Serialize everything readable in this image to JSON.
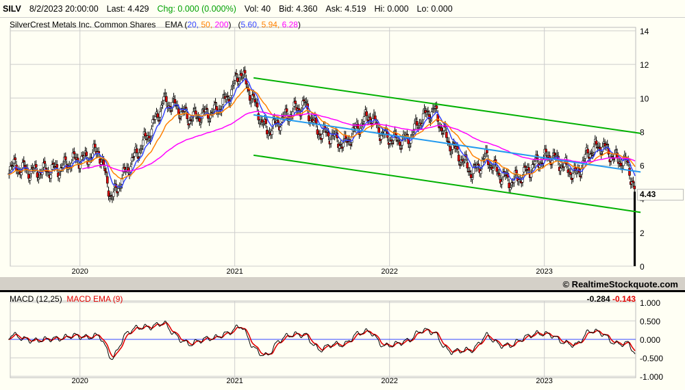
{
  "quote": {
    "symbol": "SILV",
    "datetime": "8/2/2023 20:00:00",
    "last": "Last: 4.429",
    "chg": "Chg: 0.000 (0.000%)",
    "vol": "Vol: 40",
    "bid": "Bid: 4.360",
    "ask": "Ask: 4.519",
    "hi": "Hi: 0.000",
    "lo": "Lo: 0.000"
  },
  "legend": {
    "name": "SilverCrest Metals Inc. Common Shares",
    "ema_label": "EMA",
    "p1": "20,",
    "p2": "50,",
    "p3": "200",
    "v1": "5.60,",
    "v2": "5.94,",
    "v3": "6.28"
  },
  "last_price_tag": "4.43",
  "copyright": "© RealtimeStockquote.com",
  "macd": {
    "label": "MACD (12,25)",
    "signal_label": "MACD EMA (9)",
    "value": "-0.284",
    "signal_value": "-0.143"
  },
  "colors": {
    "ema20": "#3344ff",
    "ema50": "#ff8000",
    "ema200": "#ff00ff",
    "channel": "#00b000",
    "regression": "#2299ee",
    "macd": "#000000",
    "signal": "#e00000",
    "zero": "#3344ff"
  },
  "chart_data": [
    {
      "type": "candlestick",
      "title": "SilverCrest Metals Inc. Common Shares",
      "x_ticks": [
        "2020",
        "2021",
        "2022",
        "2023"
      ],
      "y_ticks": [
        "0",
        "2",
        "4",
        "6",
        "8",
        "10",
        "12",
        "14"
      ],
      "ylim": [
        0,
        14
      ],
      "grid": true,
      "monthly_close": [
        [
          "2019-07",
          6.0
        ],
        [
          "2019-08",
          5.8
        ],
        [
          "2019-09",
          5.6
        ],
        [
          "2019-10",
          5.7
        ],
        [
          "2019-11",
          5.8
        ],
        [
          "2019-12",
          6.3
        ],
        [
          "2020-01",
          6.4
        ],
        [
          "2020-02",
          6.9
        ],
        [
          "2020-03",
          4.0
        ],
        [
          "2020-04",
          5.5
        ],
        [
          "2020-05",
          6.8
        ],
        [
          "2020-06",
          8.0
        ],
        [
          "2020-07",
          9.8
        ],
        [
          "2020-08",
          9.5
        ],
        [
          "2020-09",
          8.8
        ],
        [
          "2020-10",
          9.0
        ],
        [
          "2020-11",
          9.2
        ],
        [
          "2020-12",
          10.0
        ],
        [
          "2021-01",
          11.6
        ],
        [
          "2021-02",
          9.8
        ],
        [
          "2021-03",
          8.0
        ],
        [
          "2021-04",
          8.6
        ],
        [
          "2021-05",
          9.2
        ],
        [
          "2021-06",
          9.6
        ],
        [
          "2021-07",
          8.0
        ],
        [
          "2021-08",
          7.8
        ],
        [
          "2021-09",
          7.2
        ],
        [
          "2021-10",
          8.2
        ],
        [
          "2021-11",
          9.0
        ],
        [
          "2021-12",
          7.8
        ],
        [
          "2022-01",
          7.5
        ],
        [
          "2022-02",
          7.5
        ],
        [
          "2022-03",
          8.8
        ],
        [
          "2022-04",
          9.3
        ],
        [
          "2022-05",
          7.5
        ],
        [
          "2022-06",
          6.5
        ],
        [
          "2022-07",
          5.5
        ],
        [
          "2022-08",
          6.5
        ],
        [
          "2022-09",
          5.5
        ],
        [
          "2022-10",
          5.0
        ],
        [
          "2022-11",
          5.5
        ],
        [
          "2022-12",
          6.2
        ],
        [
          "2023-01",
          6.6
        ],
        [
          "2023-02",
          6.0
        ],
        [
          "2023-03",
          5.4
        ],
        [
          "2023-04",
          6.8
        ],
        [
          "2023-05",
          7.2
        ],
        [
          "2023-06",
          6.4
        ],
        [
          "2023-07",
          6.1
        ],
        [
          "2023-08-02",
          4.43
        ]
      ],
      "last_bar": {
        "high": 4.43,
        "low": 0.0
      },
      "channel_upper": [
        [
          "2021-02",
          11.2
        ],
        [
          "2023-08",
          7.9
        ]
      ],
      "channel_lower": [
        [
          "2021-02",
          6.6
        ],
        [
          "2023-08",
          3.2
        ]
      ],
      "regression": [
        [
          "2021-02",
          9.0
        ],
        [
          "2023-08",
          5.6
        ]
      ],
      "ema_periods": [
        20,
        50,
        200
      ]
    },
    {
      "type": "line",
      "title": "MACD (12,25)",
      "y_ticks": [
        "1.000",
        "0.500",
        "0.000",
        "-0.500",
        "-1.000"
      ],
      "ylim": [
        -1,
        1
      ],
      "x_ticks": [
        "2020",
        "2021",
        "2022",
        "2023"
      ]
    }
  ]
}
